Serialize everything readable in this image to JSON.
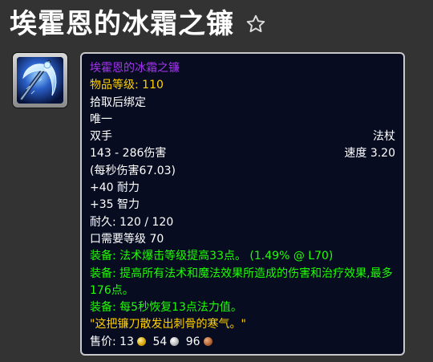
{
  "page": {
    "title": "埃霍恩的冰霜之镰"
  },
  "icons": {
    "favorite": "star-outline-icon",
    "item": "frost-scythe-icon"
  },
  "colors": {
    "background": "#333333",
    "tooltip_bg": "#070c21",
    "tooltip_border": "#c8c8c8",
    "epic_quality": "#a335ee",
    "item_level": "#ffd100",
    "equip_effect": "#1eff00",
    "flavor_text": "#ffd100"
  },
  "item": {
    "name": "埃霍恩的冰霜之镰",
    "item_level_label": "物品等级:",
    "item_level_value": "110",
    "binding": "拾取后绑定",
    "uniqueness": "唯一",
    "slot": "双手",
    "type": "法杖",
    "damage": "143 - 286伤害",
    "speed": "速度 3.20",
    "dps": "(每秒伤害67.03)",
    "stats": [
      "+40 耐力",
      "+35 智力"
    ],
    "durability": "耐久: 120 / 120",
    "required_level": "口需要等级 70",
    "equip_effects": [
      "装备: 法术爆击等级提高33点。 (1.49% @ L70)",
      "装备: 提高所有法术和魔法效果所造成的伤害和治疗效果,最多176点。",
      "装备: 每5秒恢复13点法力值。"
    ],
    "flavor": "\"这把镰刀散发出刺骨的寒气。\"",
    "sell_label": "售价:",
    "sell_gold": "13",
    "sell_silver": "54",
    "sell_copper": "96"
  }
}
